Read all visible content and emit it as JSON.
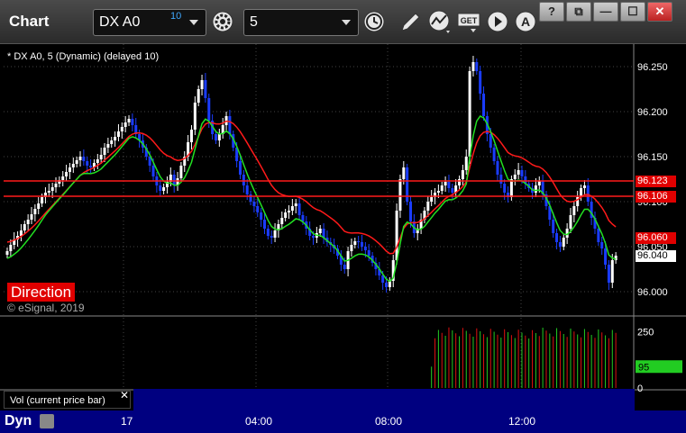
{
  "window": {
    "title": "Chart",
    "symbol": "DX A0",
    "symbol_superscript": "10",
    "interval": "5",
    "help_label": "?",
    "restore_label": "⧉",
    "minimize_label": "—",
    "maximize_label": "☐",
    "close_label": "✕"
  },
  "toolbar_icons": [
    "gear-icon",
    "clock-icon",
    "pencil-icon",
    "study-icon",
    "get-icon",
    "play-icon",
    "alert-icon"
  ],
  "chart_header": "* DX A0, 5 (Dynamic) (delayed 10)",
  "direction_label": "Direction",
  "copyright": "© eSignal, 2019",
  "price_axis": {
    "labels": [
      "96.250",
      "96.200",
      "96.150",
      "96.100",
      "96.050",
      "96.000"
    ]
  },
  "price_tags": [
    {
      "label": "96.123",
      "value": 96.123,
      "bg": "#e00000",
      "fg": "#ffffff"
    },
    {
      "label": "96.106",
      "value": 96.106,
      "bg": "#e00000",
      "fg": "#ffffff"
    },
    {
      "label": "96.060",
      "value": 96.06,
      "bg": "#e00000",
      "fg": "#ffffff"
    },
    {
      "label": "96.040",
      "value": 96.04,
      "bg": "#ffffff",
      "fg": "#000000"
    }
  ],
  "volume_axis": {
    "labels": [
      "250",
      "0"
    ]
  },
  "volume_tag": {
    "label": "95",
    "bg": "#22cc22"
  },
  "volume_label": "Vol (current price bar)",
  "volume_close": "✕",
  "footer": {
    "mode": "Dyn",
    "time_labels": [
      "17",
      "04:00",
      "08:00",
      "12:00"
    ]
  },
  "colors": {
    "up": "#ffffff",
    "down": "#1a3cff",
    "red_line": "#ff1a1a",
    "green_line": "#22e022",
    "footer_bg": "#000080"
  },
  "chart_data": {
    "type": "candlestick",
    "y_range": [
      95.975,
      96.275
    ],
    "closes": [
      96.045,
      96.052,
      96.058,
      96.062,
      96.068,
      96.075,
      96.08,
      96.086,
      96.092,
      96.098,
      96.105,
      96.11,
      96.112,
      96.116,
      96.12,
      96.124,
      96.128,
      96.133,
      96.138,
      96.142,
      96.146,
      96.15,
      96.145,
      96.14,
      96.138,
      96.143,
      96.147,
      96.152,
      96.16,
      96.164,
      96.168,
      96.172,
      96.178,
      96.183,
      96.188,
      96.192,
      96.185,
      96.175,
      96.168,
      96.16,
      96.15,
      96.14,
      96.128,
      96.118,
      96.112,
      96.116,
      96.122,
      96.13,
      96.118,
      96.126,
      96.14,
      96.15,
      96.166,
      96.18,
      96.21,
      96.225,
      96.235,
      96.215,
      96.19,
      96.175,
      96.168,
      96.175,
      96.185,
      96.195,
      96.175,
      96.16,
      96.145,
      96.13,
      96.118,
      96.108,
      96.1,
      96.095,
      96.088,
      96.08,
      96.07,
      96.062,
      96.06,
      96.068,
      96.075,
      96.082,
      96.088,
      96.09,
      96.095,
      96.098,
      96.085,
      96.078,
      96.07,
      96.062,
      96.06,
      96.065,
      96.07,
      96.06,
      96.055,
      96.052,
      96.048,
      96.04,
      96.03,
      96.025,
      96.045,
      96.052,
      96.056,
      96.055,
      96.05,
      96.046,
      96.04,
      96.032,
      96.025,
      96.018,
      96.01,
      96.005,
      96.012,
      96.035,
      96.09,
      96.125,
      96.138,
      96.1,
      96.078,
      96.065,
      96.07,
      96.08,
      96.09,
      96.1,
      96.105,
      96.11,
      96.112,
      96.118,
      96.122,
      96.115,
      96.11,
      96.118,
      96.125,
      96.135,
      96.15,
      96.245,
      96.255,
      96.245,
      96.22,
      96.195,
      96.175,
      96.16,
      96.145,
      96.13,
      96.12,
      96.11,
      96.105,
      96.125,
      96.13,
      96.135,
      96.128,
      96.12,
      96.115,
      96.11,
      96.118,
      96.123,
      96.108,
      96.095,
      96.08,
      96.065,
      96.055,
      96.05,
      96.06,
      96.07,
      96.085,
      96.095,
      96.105,
      96.115,
      96.118,
      96.1,
      96.082,
      96.07,
      96.055,
      96.048,
      96.03,
      96.01,
      96.035,
      96.04
    ],
    "volume_start_index": 122,
    "volume_max": 280
  }
}
